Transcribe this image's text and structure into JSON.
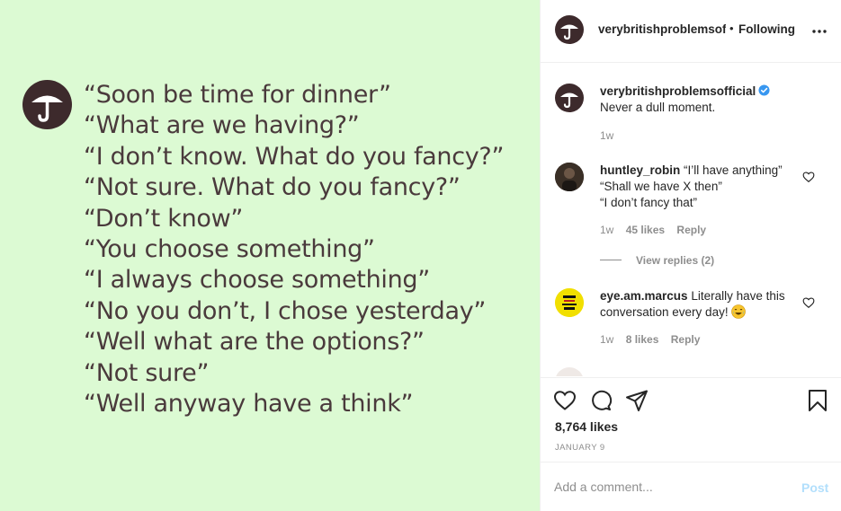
{
  "image": {
    "quote_lines": [
      "“Soon be time for dinner”",
      "“What are we having?”",
      "“I don’t know. What do you fancy?”",
      "“Not sure. What do you fancy?”",
      "“Don’t know”",
      "“You choose something”",
      "“I always choose something”",
      "“No you don’t, I chose yesterday”",
      "“Well what are the options?”",
      "“Not sure”",
      "“Well anyway have a think”"
    ],
    "background_color": "#dcfad3",
    "logo_icon": "umbrella-icon"
  },
  "header": {
    "username": "verybritishproblemsofficial",
    "separator": "•",
    "follow_status": "Following",
    "more_icon": "more-options-icon"
  },
  "caption": {
    "username": "verybritishproblemsofficial",
    "text": "Never a dull moment.",
    "time": "1w"
  },
  "comments": [
    {
      "username": "huntley_robin",
      "lines": [
        "“I’ll have anything”",
        "“Shall we have X then”",
        "“I don’t fancy that”"
      ],
      "time": "1w",
      "likes": "45 likes",
      "reply": "Reply",
      "view_replies": "View replies (2)"
    },
    {
      "username": "eye.am.marcus",
      "text": "Literally have this conversation every day!",
      "emoji": "laughing-tears-emoji",
      "time": "1w",
      "likes": "8 likes",
      "reply": "Reply"
    }
  ],
  "actions": {
    "likes": "8,764 likes",
    "date": "JANUARY 9"
  },
  "add_comment": {
    "placeholder": "Add a comment...",
    "post_label": "Post"
  },
  "colors": {
    "verified_blue": "#3897f0",
    "post_button_disabled": "#b2dffc",
    "brand_avatar": "#3d2a2c"
  }
}
